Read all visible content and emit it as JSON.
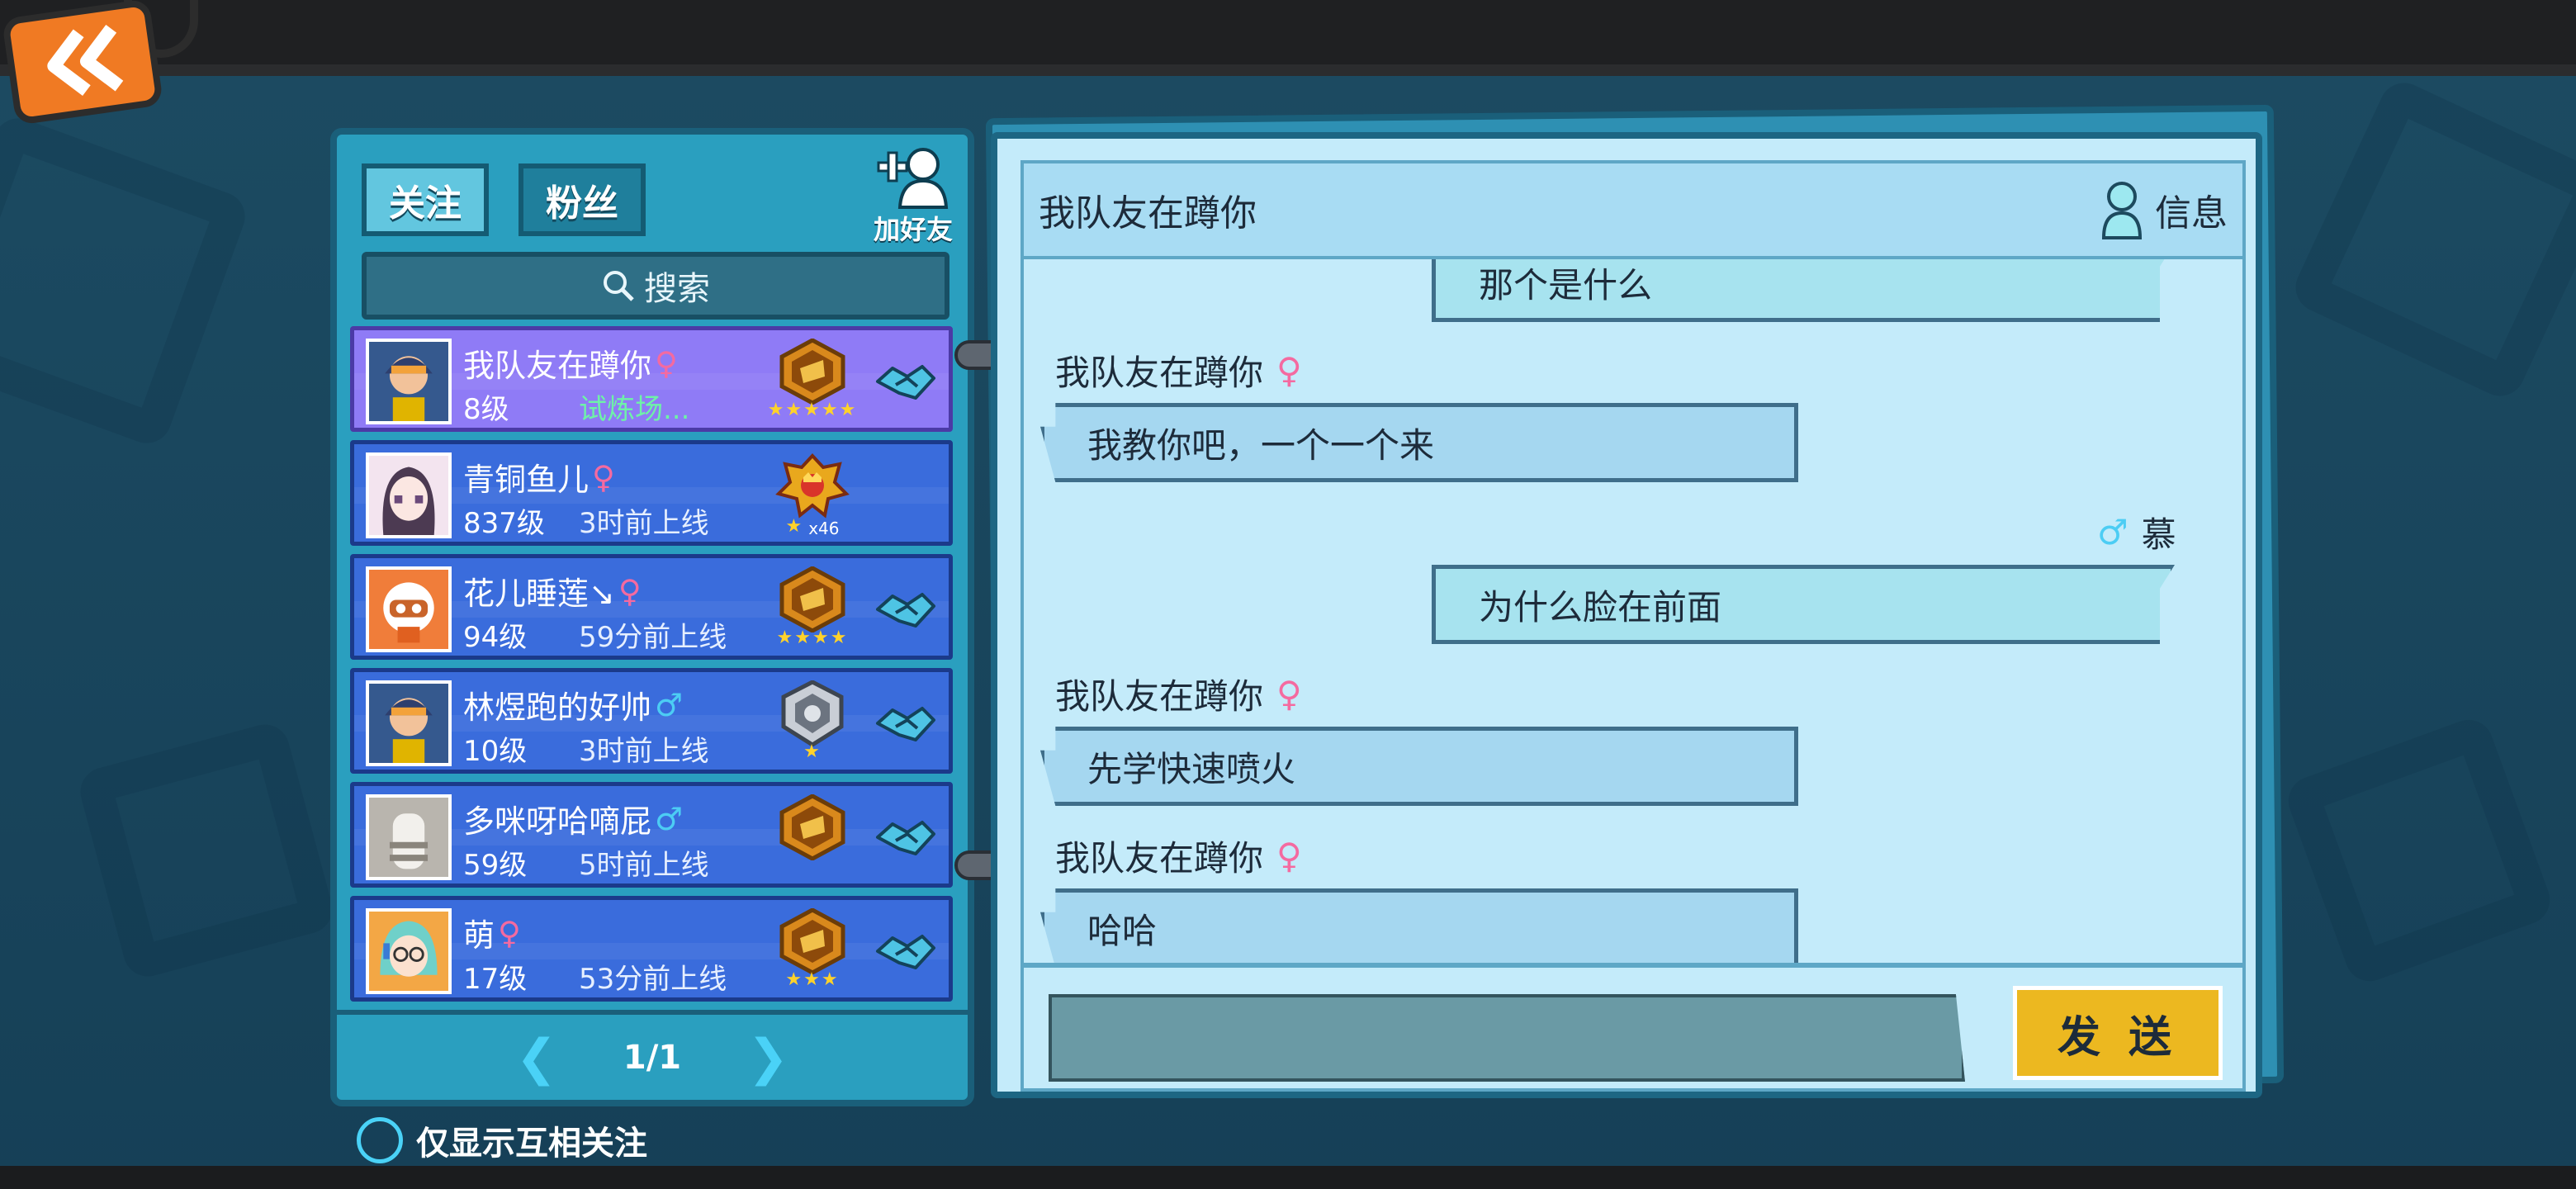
{
  "app": {
    "back_icon": "double-chevron-left-icon"
  },
  "friends_panel": {
    "tabs": [
      {
        "label": "关注",
        "active": true
      },
      {
        "label": "粉丝",
        "active": false
      }
    ],
    "add_friend_label": "加好友",
    "search_label": "搜索",
    "friends": [
      {
        "name": "我队友在蹲你",
        "gender": "♀",
        "gender_type": "female",
        "level": "8级",
        "status": "试炼场...",
        "status_style": "green",
        "stars": "★★★★★",
        "rank_count": "",
        "has_handshake": true,
        "selected": true
      },
      {
        "name": "青铜鱼儿",
        "gender": "♀",
        "gender_type": "female",
        "level": "837级",
        "status": "3时前上线",
        "status_style": "normal",
        "stars": "★",
        "rank_count": "x46",
        "has_handshake": false,
        "selected": false
      },
      {
        "name": "花儿睡莲↘",
        "gender": "♀",
        "gender_type": "female",
        "level": "94级",
        "status": "59分前上线",
        "status_style": "normal",
        "stars": "★★★★",
        "rank_count": "",
        "has_handshake": true,
        "selected": false
      },
      {
        "name": "林煜跑的好帅",
        "gender": "♂",
        "gender_type": "male",
        "level": "10级",
        "status": "3时前上线",
        "status_style": "normal",
        "stars": "★",
        "rank_count": "",
        "has_handshake": true,
        "selected": false
      },
      {
        "name": "多咪呀哈嘀屁",
        "gender": "♂",
        "gender_type": "male",
        "level": "59级",
        "status": "5时前上线",
        "status_style": "normal",
        "stars": "",
        "rank_count": "",
        "has_handshake": true,
        "selected": false
      },
      {
        "name": "萌",
        "gender": "♀",
        "gender_type": "female",
        "level": "17级",
        "status": "53分前上线",
        "status_style": "normal",
        "stars": "★★★",
        "rank_count": "",
        "has_handshake": true,
        "selected": false
      }
    ],
    "pager": {
      "label": "1/1"
    },
    "mutual_only_label": "仅显示互相关注"
  },
  "chat": {
    "title": "我队友在蹲你",
    "info_label": "信息",
    "messages": [
      {
        "from": "me",
        "name": "",
        "gender": "",
        "text": "那个是什么"
      },
      {
        "from": "other",
        "name": "我队友在蹲你",
        "gender": "♀",
        "text": "我教你吧，一个一个来"
      },
      {
        "from": "me",
        "name": "慕",
        "gender": "♂",
        "text": "为什么脸在前面"
      },
      {
        "from": "other",
        "name": "我队友在蹲你",
        "gender": "♀",
        "text": "先学快速喷火"
      },
      {
        "from": "other",
        "name": "我队友在蹲你",
        "gender": "♀",
        "text": "哈哈"
      }
    ],
    "input_value": "",
    "send_label": "发 送"
  },
  "colors": {
    "female": "#f46aa0",
    "male": "#4ccdf4",
    "send": "#ecb820",
    "selected_row": "#8f7bf6",
    "row": "#3a6cdc"
  }
}
